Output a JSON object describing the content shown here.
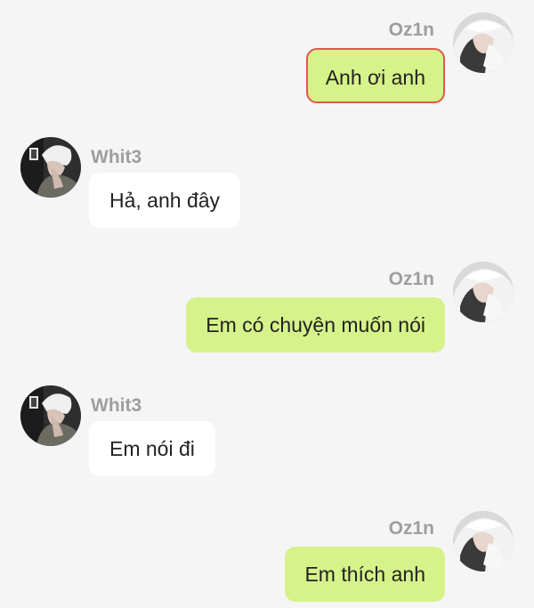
{
  "messages": [
    {
      "side": "sent",
      "sender": "Oz1n",
      "text": "Anh ơi anh",
      "selected": true
    },
    {
      "side": "recv",
      "sender": "Whit3",
      "text": "Hả, anh đây"
    },
    {
      "side": "sent",
      "sender": "Oz1n",
      "text": "Em có chuyện muốn nói"
    },
    {
      "side": "recv",
      "sender": "Whit3",
      "text": "Em nói đi"
    },
    {
      "side": "sent",
      "sender": "Oz1n",
      "text": "Em thích anh"
    }
  ],
  "colors": {
    "background": "#f5f5f5",
    "sent_bubble": "#d6f28a",
    "received_bubble": "#ffffff",
    "sender_name": "#9e9e9e",
    "selection_border": "#e0584a"
  },
  "icons": {
    "sent_avatar": "avatar-photo-oz1n",
    "received_avatar": "avatar-photo-whit3"
  }
}
